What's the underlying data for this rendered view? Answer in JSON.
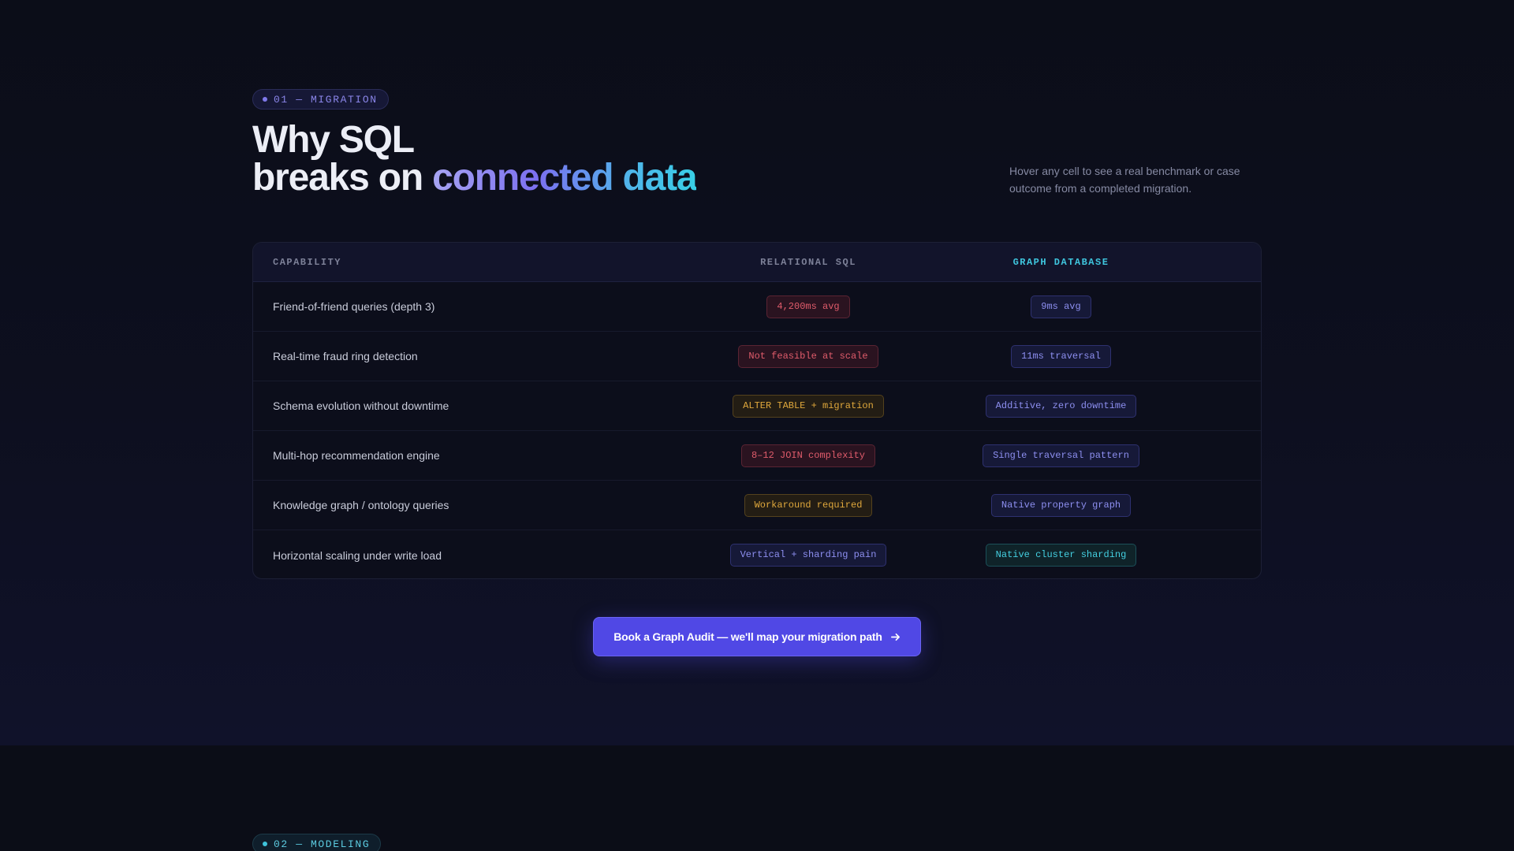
{
  "section1": {
    "eyebrow": "01 — MIGRATION",
    "headline_line1": "Why SQL",
    "headline_line2_plain": "breaks on ",
    "headline_line2_accent": "connected data",
    "hint": "Hover any cell to see a real benchmark or case outcome from a completed migration.",
    "table": {
      "headers": {
        "capability": "CAPABILITY",
        "sql": "RELATIONAL SQL",
        "graph": "GRAPH DATABASE"
      },
      "rows": [
        {
          "capability": "Friend-of-friend queries (depth 3)",
          "sql": "4,200ms avg",
          "sql_tone": "red",
          "graph": "9ms avg",
          "graph_tone": "blue"
        },
        {
          "capability": "Real-time fraud ring detection",
          "sql": "Not feasible at scale",
          "sql_tone": "red",
          "graph": "11ms traversal",
          "graph_tone": "blue"
        },
        {
          "capability": "Schema evolution without downtime",
          "sql": "ALTER TABLE + migration",
          "sql_tone": "amber",
          "graph": "Additive, zero downtime",
          "graph_tone": "blue"
        },
        {
          "capability": "Multi-hop recommendation engine",
          "sql": "8–12 JOIN complexity",
          "sql_tone": "red",
          "graph": "Single traversal pattern",
          "graph_tone": "blue"
        },
        {
          "capability": "Knowledge graph / ontology queries",
          "sql": "Workaround required",
          "sql_tone": "amber",
          "graph": "Native property graph",
          "graph_tone": "blue"
        },
        {
          "capability": "Horizontal scaling under write load",
          "sql": "Vertical + sharding pain",
          "sql_tone": "blue",
          "graph": "Native cluster sharding",
          "graph_tone": "teal"
        }
      ]
    },
    "cta_label": "Book a Graph Audit — we'll map your migration path",
    "cta_icon": "arrow-right-icon"
  },
  "section2": {
    "eyebrow": "02 — MODELING"
  },
  "colors": {
    "accent": "#5048e5",
    "teal": "#3fc6de",
    "red": "#e05c6b",
    "amber": "#e0a83c",
    "background": "#0b0d18"
  }
}
